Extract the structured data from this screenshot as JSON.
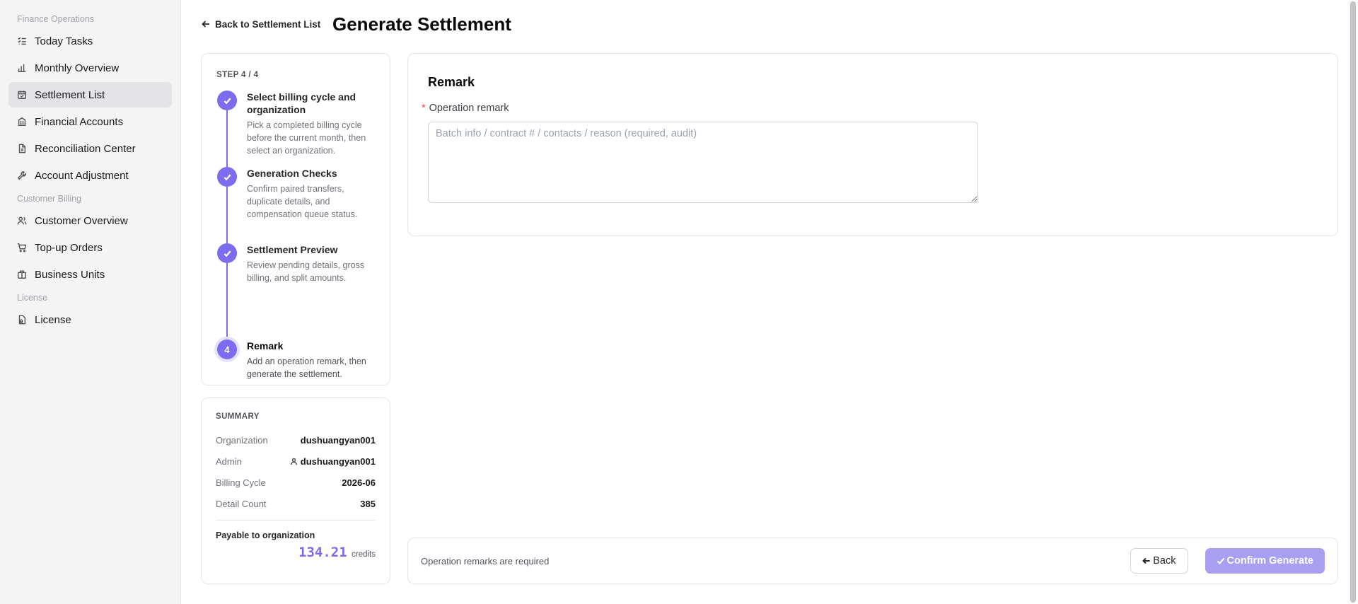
{
  "sidebar": {
    "sections": [
      {
        "label": "Finance Operations"
      },
      {
        "label": "Customer Billing"
      },
      {
        "label": "License"
      }
    ],
    "items": [
      {
        "label": "Today Tasks",
        "icon": "task-list-icon"
      },
      {
        "label": "Monthly Overview",
        "icon": "bar-chart-icon"
      },
      {
        "label": "Settlement List",
        "icon": "calendar-check-icon",
        "active": true
      },
      {
        "label": "Financial Accounts",
        "icon": "bank-icon"
      },
      {
        "label": "Reconciliation Center",
        "icon": "document-icon"
      },
      {
        "label": "Account Adjustment",
        "icon": "wrench-icon"
      },
      {
        "label": "Customer Overview",
        "icon": "users-icon"
      },
      {
        "label": "Top-up Orders",
        "icon": "cart-icon"
      },
      {
        "label": "Business Units",
        "icon": "building-icon"
      },
      {
        "label": "License",
        "icon": "license-icon"
      }
    ]
  },
  "header": {
    "back_label": "Back to Settlement List",
    "title": "Generate Settlement"
  },
  "steps": {
    "counter": "STEP 4 / 4",
    "items": [
      {
        "number": "1",
        "title": "Select billing cycle and organization",
        "desc": "Pick a completed billing cycle before the current month, then select an organization.",
        "status": "done"
      },
      {
        "number": "2",
        "title": "Generation Checks",
        "desc": "Confirm paired transfers, duplicate details, and compensation queue status.",
        "status": "done"
      },
      {
        "number": "3",
        "title": "Settlement Preview",
        "desc": "Review pending details, gross billing, and split amounts.",
        "status": "done"
      },
      {
        "number": "4",
        "title": "Remark",
        "desc": "Add an operation remark, then generate the settlement.",
        "status": "current"
      }
    ]
  },
  "summary": {
    "title": "SUMMARY",
    "organization_label": "Organization",
    "organization_value": "dushuangyan001",
    "admin_label": "Admin",
    "admin_value": "dushuangyan001",
    "billing_cycle_label": "Billing Cycle",
    "billing_cycle_value": "2026-06",
    "detail_count_label": "Detail Count",
    "detail_count_value": "385",
    "payable_label": "Payable to organization",
    "payable_amount": "134.21",
    "payable_unit": "credits"
  },
  "remark": {
    "title": "Remark",
    "required_mark": "*",
    "field_label": "Operation remark",
    "value": "",
    "placeholder": "Batch info / contract # / contacts / reason (required, audit)"
  },
  "footer": {
    "note": "Operation remarks are required",
    "back_label": "Back",
    "confirm_label": "Confirm Generate"
  },
  "colors": {
    "accent": "#7c6cf0",
    "accent_disabled": "#a99ff2",
    "required": "#ef4444"
  }
}
